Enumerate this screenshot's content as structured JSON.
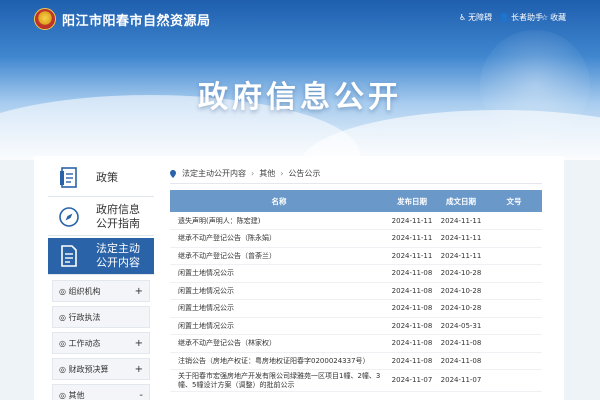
{
  "header": {
    "site_title": "阳江市阳春市自然资源局",
    "tools": [
      {
        "icon": "accessibility-icon",
        "label": "无障碍"
      },
      {
        "icon": "elderly-assist-icon",
        "label": "长者助手"
      },
      {
        "icon": "star-icon",
        "label": "收藏"
      }
    ],
    "banner_title": "政府信息公开"
  },
  "sidebar": {
    "tabs": [
      {
        "label_line1": "政策",
        "label_line2": "",
        "icon": "policy-document-icon",
        "active": false
      },
      {
        "label_line1": "政府信息",
        "label_line2": "公开指南",
        "icon": "compass-icon",
        "active": false
      },
      {
        "label_line1": "法定主动",
        "label_line2": "公开内容",
        "icon": "document-list-icon",
        "active": true
      }
    ],
    "sub_items": [
      {
        "label": "◎ 组织机构",
        "toggle": "+"
      },
      {
        "label": "◎ 行政执法",
        "toggle": ""
      },
      {
        "label": "◎ 工作动态",
        "toggle": "+"
      },
      {
        "label": "◎ 财政预决算",
        "toggle": "+"
      },
      {
        "label": "◎ 其他",
        "toggle": "-"
      }
    ]
  },
  "breadcrumb": [
    "法定主动公开内容",
    "其他",
    "公告公示"
  ],
  "table": {
    "headers": [
      "名称",
      "发布日期",
      "成文日期",
      "文号"
    ],
    "rows": [
      {
        "name": "遗失声明(声明人：陈宏建)",
        "pub": "2024-11-11",
        "written": "2024-11-11",
        "num": ""
      },
      {
        "name": "继承不动产登记公告（陈永娟）",
        "pub": "2024-11-11",
        "written": "2024-11-11",
        "num": ""
      },
      {
        "name": "继承不动产登记公告（曾荼兰）",
        "pub": "2024-11-11",
        "written": "2024-11-11",
        "num": ""
      },
      {
        "name": "闲置土地情况公示",
        "pub": "2024-11-08",
        "written": "2024-10-28",
        "num": ""
      },
      {
        "name": "闲置土地情况公示",
        "pub": "2024-11-08",
        "written": "2024-10-28",
        "num": ""
      },
      {
        "name": "闲置土地情况公示",
        "pub": "2024-11-08",
        "written": "2024-10-28",
        "num": ""
      },
      {
        "name": "闲置土地情况公示",
        "pub": "2024-11-08",
        "written": "2024-05-31",
        "num": ""
      },
      {
        "name": "继承不动产登记公告（林家权）",
        "pub": "2024-11-08",
        "written": "2024-11-08",
        "num": ""
      },
      {
        "name": "注销公告（房地产权证：粤房地权证阳春字0200024337号）",
        "pub": "2024-11-08",
        "written": "2024-11-08",
        "num": ""
      },
      {
        "name": "关于阳春市宏强房地产开发有限公司绿雅苑一区项目1幢、2幢、3幢、5幢设计方案（调整）的批前公示",
        "pub": "2024-11-07",
        "written": "2024-11-07",
        "num": ""
      }
    ]
  }
}
